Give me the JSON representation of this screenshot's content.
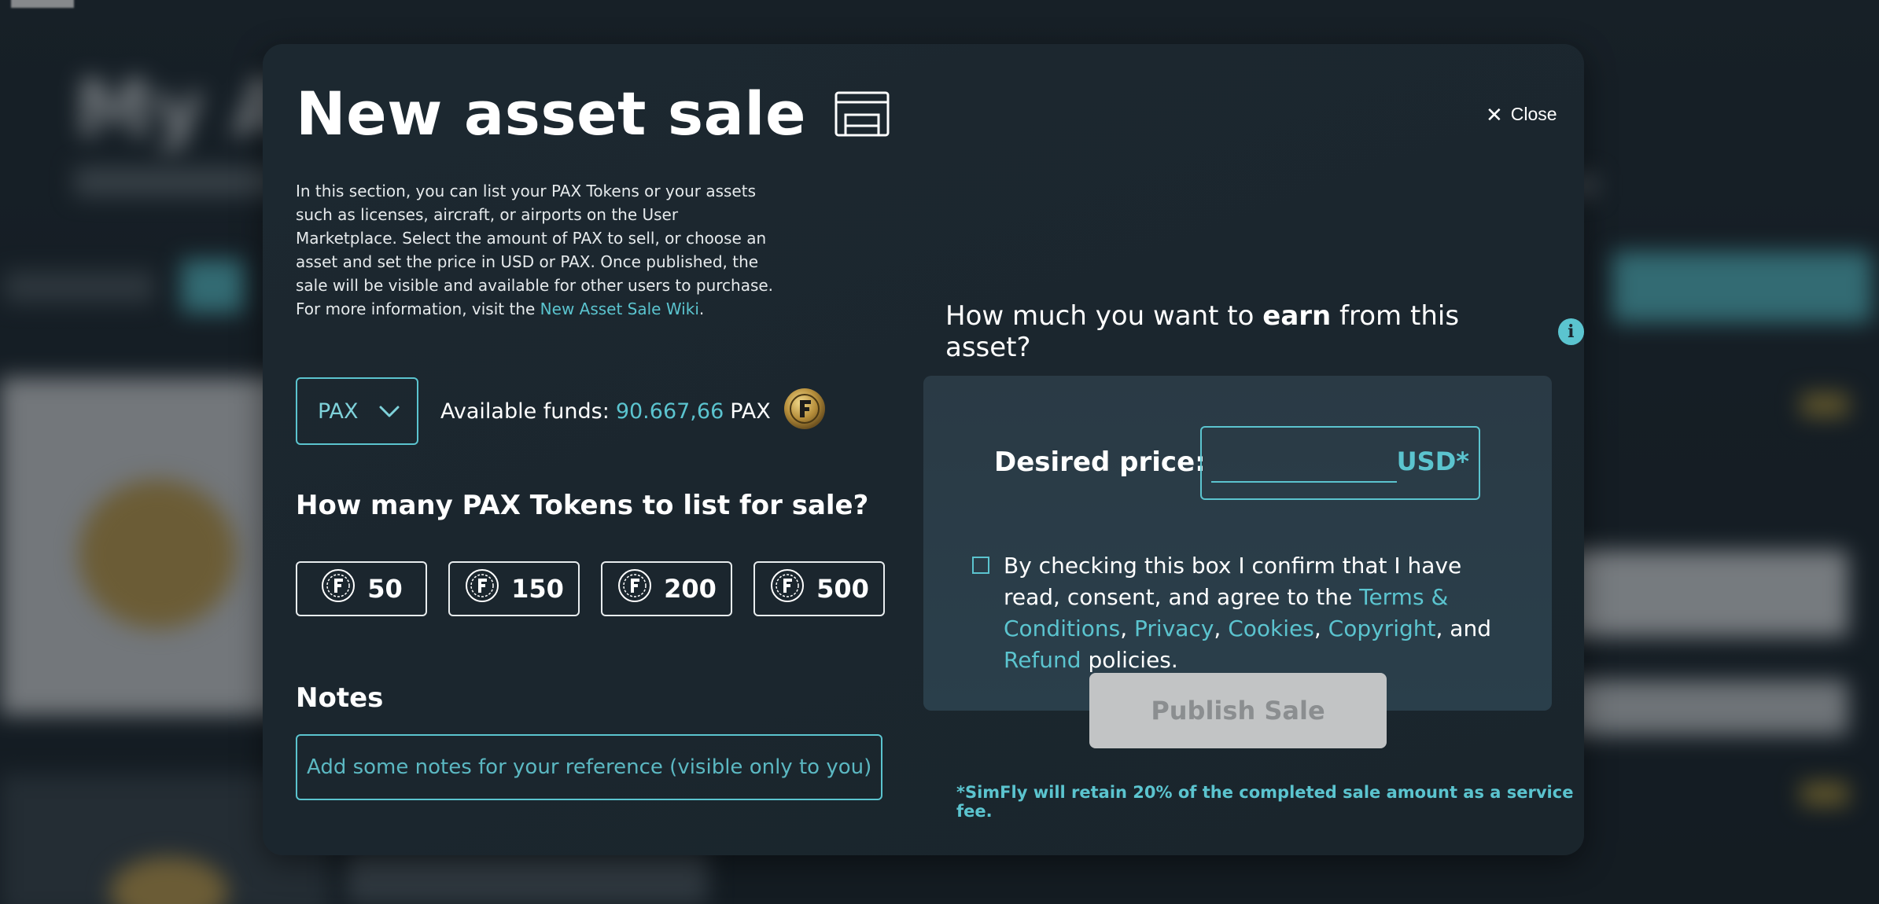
{
  "modal": {
    "title": "New asset sale",
    "close_label": "Close",
    "intro_text": "In this section, you can list your PAX Tokens or your assets such as licenses, aircraft, or airports on the User Marketplace. Select the amount of PAX to sell, or choose an asset and set the price in USD or PAX. Once published, the sale will be visible and available for other users to purchase. For more information, visit the ",
    "intro_link": "New Asset Sale Wiki",
    "intro_end": "."
  },
  "currency": {
    "selected": "PAX"
  },
  "funds": {
    "label": "Available funds:",
    "amount": "90.667,66",
    "unit": "PAX"
  },
  "tokens": {
    "question": "How many PAX Tokens to list for sale?",
    "options": [
      "50",
      "150",
      "200",
      "500"
    ]
  },
  "notes": {
    "label": "Notes",
    "placeholder": "Add some notes for your reference (visible only to you)"
  },
  "earn": {
    "question_pre": "How much you want to ",
    "question_bold": "earn",
    "question_post": " from this asset?",
    "info_glyph": "i"
  },
  "price": {
    "label": "Desired price:",
    "value": "",
    "unit": "USD*"
  },
  "consent": {
    "text_1": "By checking this box I confirm that I have read, consent, and agree to the ",
    "terms": "Terms & Conditions",
    "sep_1": ",",
    "privacy": "Privacy",
    "sep_2": ", ",
    "cookies": "Cookies",
    "sep_3": ", ",
    "copyright": "Copyright",
    "sep_4": ", and ",
    "refund": "Refund",
    "text_end": " policies.",
    "checked": false
  },
  "publish_label": "Publish Sale",
  "fee_note": "*SimFly will retain 20% of the completed sale amount as a service fee.",
  "background": {
    "title": "My A"
  },
  "colors": {
    "accent": "#5bc4cf",
    "modal_bg": "#1b262e",
    "panel_bg": "#2a3a45",
    "button_disabled": "#c2c4c5"
  },
  "icons": [
    "close-icon",
    "shop-icon",
    "chevron-down-icon",
    "pax-coin-icon",
    "token-icon",
    "info-icon",
    "checkbox"
  ]
}
